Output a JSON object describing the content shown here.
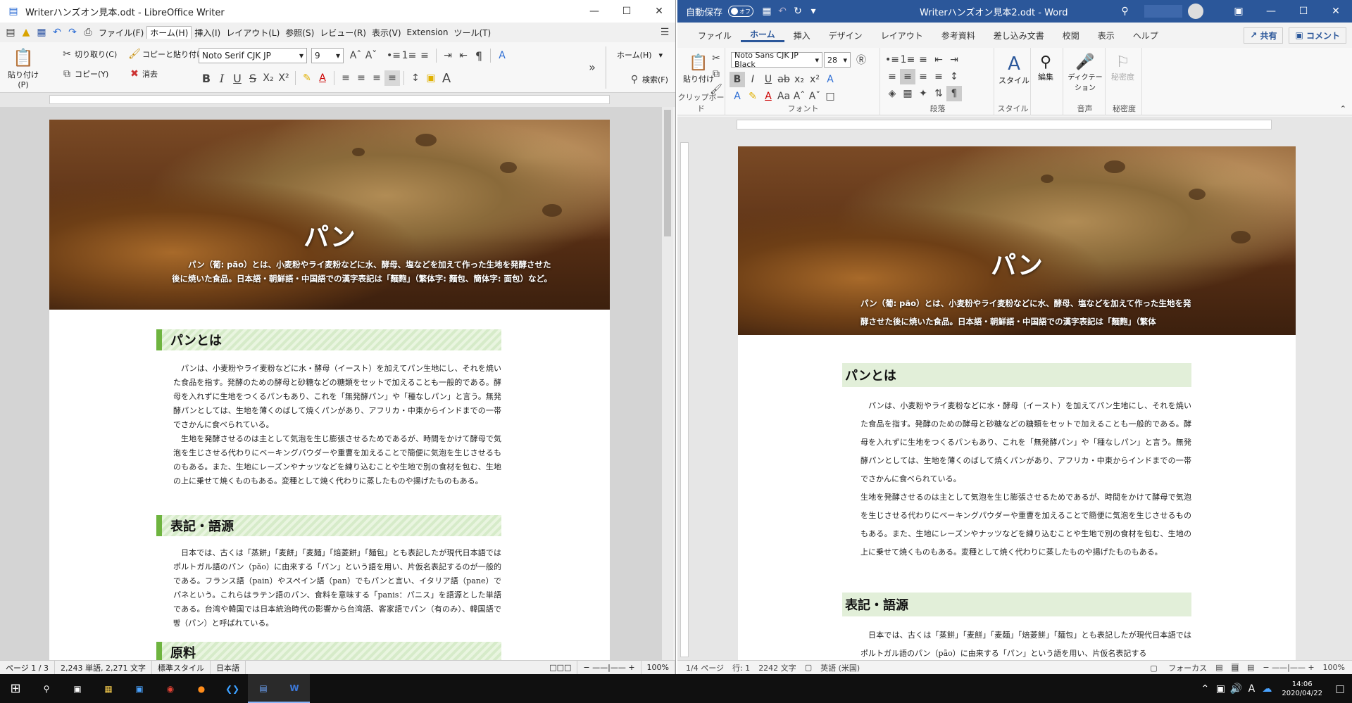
{
  "lo": {
    "title": "Writerハンズオン見本.odt - LibreOffice Writer",
    "menus": [
      "ファイル(F)",
      "ホーム(H)",
      "挿入(I)",
      "レイアウト(L)",
      "参照(S)",
      "レビュー(R)",
      "表示(V)",
      "Extension",
      "ツール(T)"
    ],
    "paste": "貼り付け(P)",
    "cut": "切り取り(C)",
    "copy": "コピー(Y)",
    "clone": "コピーと貼り付け",
    "clear": "消去",
    "font": "Noto Serif CJK JP",
    "size": "9",
    "home_box": "ホーム(H)",
    "find": "検索(F)",
    "hero_title": "パン",
    "hero_desc": "パン（葡: pão）とは、小麦粉やライ麦粉などに水、酵母、塩などを加えて作った生地を発酵させた後に焼いた食品。日本語・朝鮮語・中国語での漢字表記は「麵麭」（繁体字: 麵包、簡体字: 面包）など。",
    "h1": "パンとは",
    "p1": "パンは、小麦粉やライ麦粉などに水・酵母（イースト）を加えてパン生地にし、それを焼いた食品を指す。発酵のための酵母と砂糖などの糖類をセットで加えることも一般的である。酵母を入れずに生地をつくるパンもあり、これを「無発酵パン」や「種なしパン」と言う。無発酵パンとしては、生地を薄くのばして焼くパンがあり、アフリカ・中東からインドまでの一帯でさかんに食べられている。",
    "p2": "生地を発酵させるのは主として気泡を生じ膨張させるためであるが、時間をかけて酵母で気泡を生じさせる代わりにベーキングパウダーや重曹を加えることで簡便に気泡を生じさせるものもある。また、生地にレーズンやナッツなどを練り込むことや生地で別の食材を包む、生地の上に乗せて焼くものもある。変種として焼く代わりに蒸したものや揚げたものもある。",
    "h2": "表記・語源",
    "p3": "日本では、古くは「蒸餅」「麦餅」「麦麺」「焙菱餅」「麺包」とも表記したが現代日本語ではポルトガル語のパン（pão）に由来する「パン」という語を用い、片仮名表記するのが一般的である。フランス語（pain）やスペイン語（pan）でもパンと言い、イタリア語（pane）でパネという。これらはラテン語のパン、食料を意味する「panis：パニス」を語源とした単語である。台湾や韓国では日本統治時代の影響から台湾語、客家語でパン（有のみ）、韓国語で빵（パン）と呼ばれている。",
    "h3": "原料",
    "status": [
      "ページ 1 / 3",
      "2,243 単語, 2,271 文字",
      "標準スタイル",
      "日本語"
    ],
    "zoom": "100%"
  },
  "wd": {
    "autosave": "自動保存",
    "autosave_state": "オフ",
    "title": "Writerハンズオン見本2.odt - Word",
    "tabs": [
      "ファイル",
      "ホーム",
      "挿入",
      "デザイン",
      "レイアウト",
      "参考資料",
      "差し込み文書",
      "校閲",
      "表示",
      "ヘルプ"
    ],
    "share": "共有",
    "comment": "コメント",
    "paste": "貼り付け",
    "font": "Noto Sans CJK JP Black",
    "size": "28",
    "groups": [
      "クリップボード",
      "フォント",
      "段落",
      "スタイル",
      "音声",
      "秘密度"
    ],
    "style_btn": "スタイル",
    "edit_btn": "編集",
    "dictate_btn": "ディクテーション",
    "sens_btn": "秘密度",
    "hero_title": "パン",
    "hero_desc": "パン（葡: pão）とは、小麦粉やライ麦粉などに水、酵母、塩などを加えて作った生地を発酵させた後に焼いた食品。日本語・朝鮮語・中国語での漢字表記は「麵麭」（繁体",
    "h1": "パンとは",
    "p1": "パンは、小麦粉やライ麦粉などに水・酵母（イースト）を加えてパン生地にし、それを焼いた食品を指す。発酵のための酵母と砂糖などの糖類をセットで加えることも一般的である。酵母を入れずに生地をつくるパンもあり、これを「無発酵パン」や「種なしパン」と言う。無発酵パンとしては、生地を薄くのばして焼くパンがあり、アフリカ・中東からインドまでの一帯でさかんに食べられている。",
    "p2": "生地を発酵させるのは主として気泡を生じ膨張させるためであるが、時間をかけて酵母で気泡を生じさせる代わりにベーキングパウダーや重曹を加えることで簡便に気泡を生じさせるものもある。また、生地にレーズンやナッツなどを練り込むことや生地で別の食材を包む、生地の上に乗せて焼くものもある。変種として焼く代わりに蒸したものや揚げたものもある。",
    "h2": "表記・語源",
    "p3": "日本では、古くは「蒸餅」「麦餅」「麦麺」「焙菱餅」「麺包」とも表記したが現代日本語ではポルトガル語のパン（pão）に由来する「パン」という語を用い、片仮名表記する",
    "status": [
      "1/4 ページ",
      "行: 1",
      "2242 文字",
      "英語 (米国)",
      "フォーカス"
    ],
    "zoom": "100%"
  },
  "taskbar": {
    "time": "14:06",
    "date": "2020/04/22",
    "ime": "A"
  }
}
